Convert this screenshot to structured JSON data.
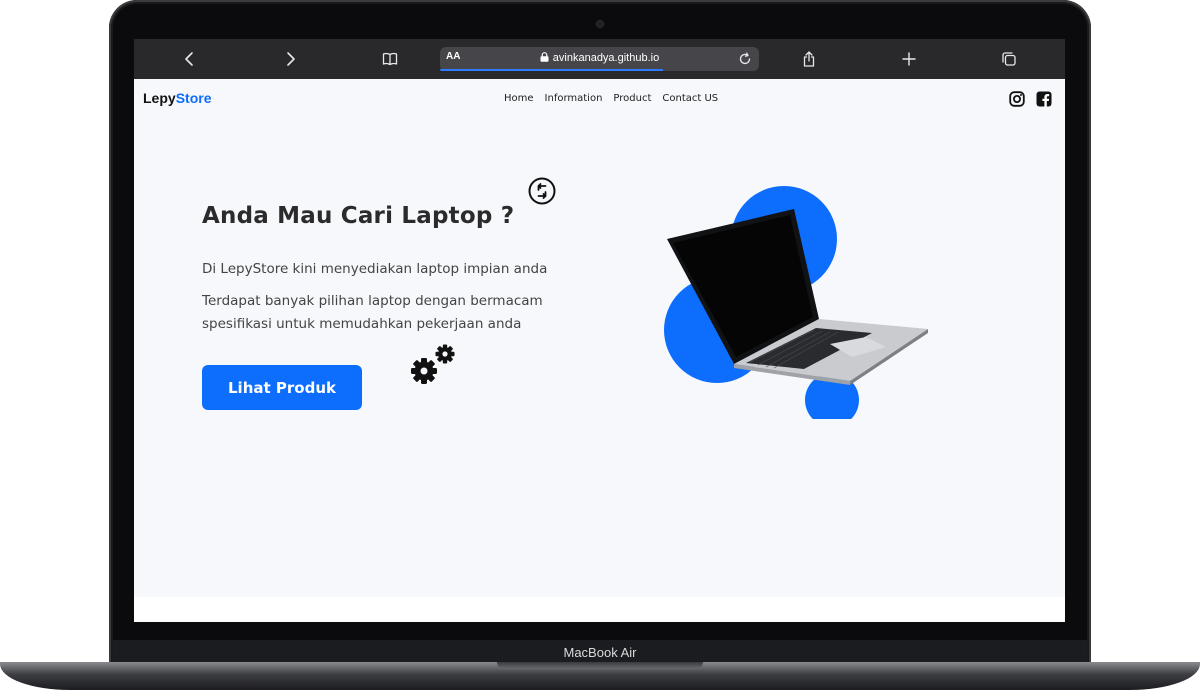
{
  "device": {
    "label": "MacBook Air"
  },
  "browser": {
    "url": "avinkanadya.github.io",
    "reader_label": "AA",
    "load_progress_fraction": 0.7
  },
  "site": {
    "logo": {
      "part1": "Lepy",
      "part2": "Store"
    },
    "nav": [
      "Home",
      "Information",
      "Product",
      "Contact US"
    ],
    "social": [
      "instagram-icon",
      "facebook-icon"
    ]
  },
  "hero": {
    "title": "Anda Mau Cari Laptop ?",
    "line1": "Di LepyStore kini menyediakan laptop impian anda",
    "line2": "Terdapat banyak pilihan laptop dengan bermacam spesifikasi untuk memudahkan pekerjaan anda",
    "button": "Lihat Produk"
  },
  "colors": {
    "accent": "#0d6efd",
    "page_bg": "#f6f8fc",
    "toolbar_bg": "#29292c"
  }
}
